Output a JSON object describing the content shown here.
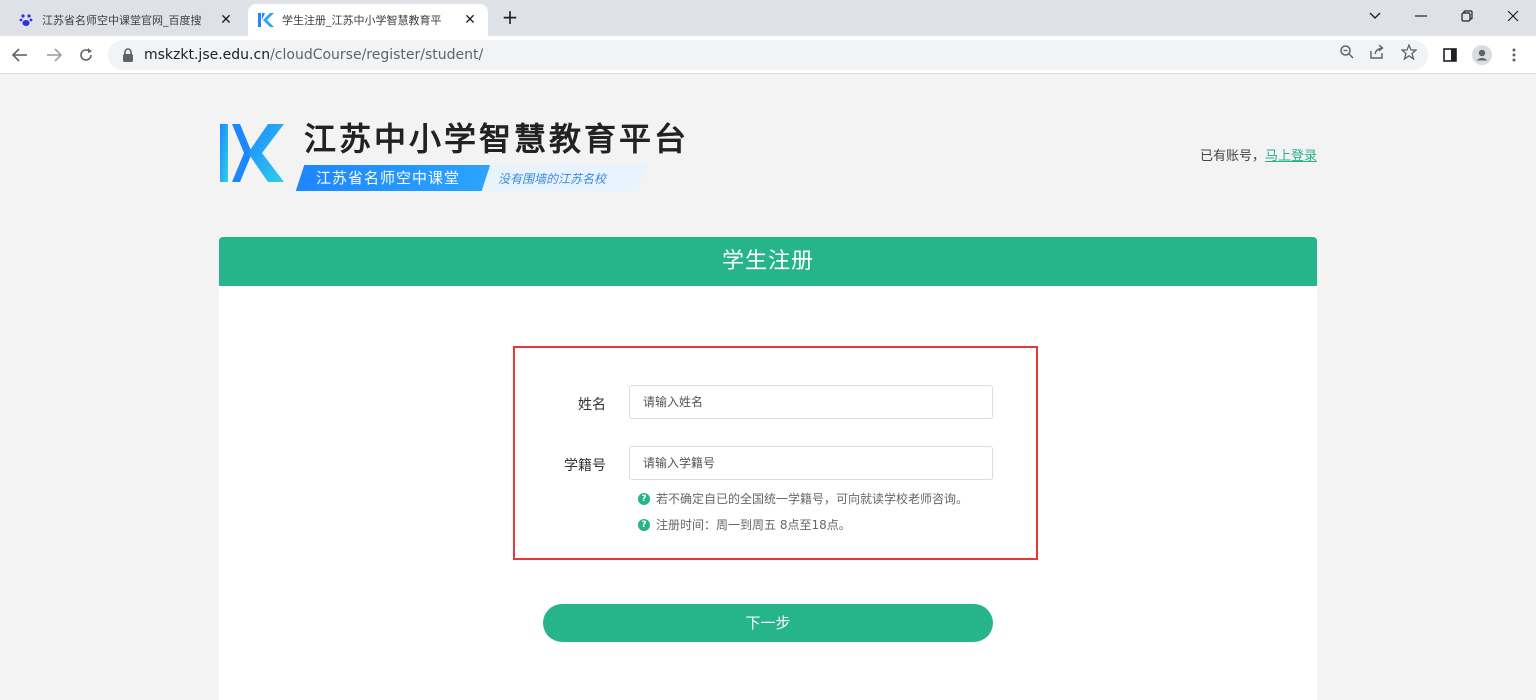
{
  "browser": {
    "tabs": [
      {
        "title": "江苏省名师空中课堂官网_百度搜",
        "active": false,
        "icon": "baidu-paw-icon"
      },
      {
        "title": "学生注册_江苏中小学智慧教育平",
        "active": true,
        "icon": "k-logo-icon"
      }
    ],
    "url_domain": "mskzkt.jse.edu.cn",
    "url_path": "/cloudCourse/register/student/"
  },
  "header": {
    "brand_title": "江苏中小学智慧教育平台",
    "brand_badge": "江苏省名师空中课堂",
    "brand_slogan": "没有围墙的江苏名校",
    "login_prompt": "已有账号，",
    "login_link": "马上登录"
  },
  "form": {
    "title": "学生注册",
    "name_label": "姓名",
    "name_placeholder": "请输入姓名",
    "student_id_label": "学籍号",
    "student_id_placeholder": "请输入学籍号",
    "tips": [
      "若不确定自已的全国统一学籍号，可向就读学校老师咨询。",
      "注册时间：周一到周五 8点至18点。"
    ],
    "next_button": "下一步"
  },
  "colors": {
    "accent": "#26b48a",
    "brand_blue": "#1e86ff",
    "highlight": "#e53935"
  }
}
